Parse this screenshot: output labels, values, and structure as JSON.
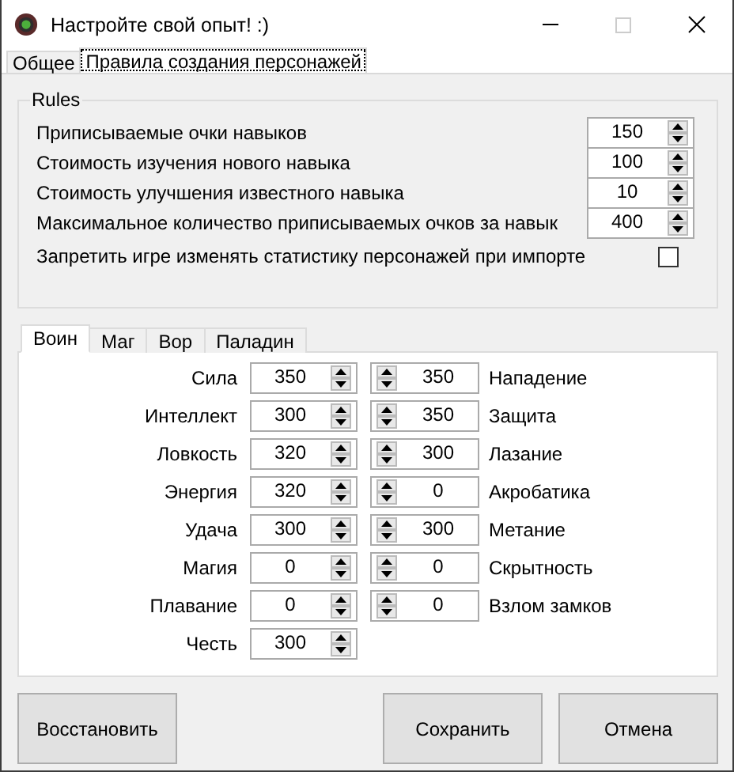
{
  "window": {
    "title": "Настройте свой опыт! :)"
  },
  "tabs": [
    {
      "label": "Общее",
      "selected": false
    },
    {
      "label": "Правила создания персонажей",
      "selected": true
    }
  ],
  "rules": {
    "title": "Rules",
    "fields": [
      {
        "label": "Приписываемые очки навыков",
        "value": "150"
      },
      {
        "label": "Стоимость изучения нового навыка",
        "value": "100"
      },
      {
        "label": "Стоимость улучшения известного навыка",
        "value": "10"
      },
      {
        "label": "Максимальное количество приписываемых очков за навык",
        "value": "400"
      }
    ],
    "checkbox": {
      "label": "Запретить игре изменять статистику персонажей при импорте",
      "checked": false
    }
  },
  "class_tabs": [
    {
      "label": "Воин",
      "selected": true
    },
    {
      "label": "Маг",
      "selected": false
    },
    {
      "label": "Вор",
      "selected": false
    },
    {
      "label": "Паладин",
      "selected": false
    }
  ],
  "stats": {
    "left": [
      {
        "label": "Сила",
        "value": "350"
      },
      {
        "label": "Интеллект",
        "value": "300"
      },
      {
        "label": "Ловкость",
        "value": "320"
      },
      {
        "label": "Энергия",
        "value": "320"
      },
      {
        "label": "Удача",
        "value": "300"
      },
      {
        "label": "Магия",
        "value": "0"
      },
      {
        "label": "Плавание",
        "value": "0"
      },
      {
        "label": "Честь",
        "value": "300"
      }
    ],
    "right": [
      {
        "label": "Нападение",
        "value": "350"
      },
      {
        "label": "Защита",
        "value": "350"
      },
      {
        "label": "Лазание",
        "value": "300"
      },
      {
        "label": "Акробатика",
        "value": "0"
      },
      {
        "label": "Метание",
        "value": "300"
      },
      {
        "label": "Скрытность",
        "value": "0"
      },
      {
        "label": "Взлом замков",
        "value": "0"
      }
    ]
  },
  "buttons": {
    "left": [
      "Восстановить"
    ],
    "right": [
      "Сохранить",
      "Отмена"
    ]
  }
}
